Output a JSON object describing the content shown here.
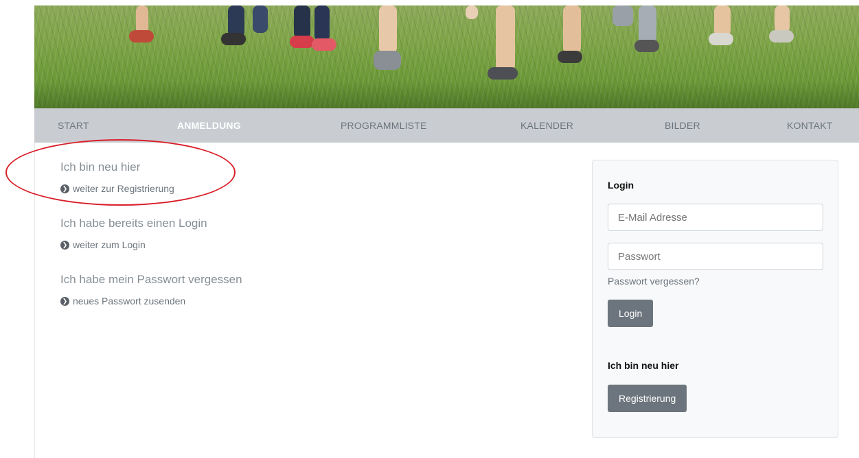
{
  "hero": {
    "alt": "children running on grass"
  },
  "nav": {
    "items": [
      {
        "label": "START",
        "active": false
      },
      {
        "label": "ANMELDUNG",
        "active": true
      },
      {
        "label": "PROGRAMMLISTE",
        "active": false
      },
      {
        "label": "KALENDER",
        "active": false
      },
      {
        "label": "BILDER",
        "active": false
      },
      {
        "label": "KONTAKT",
        "active": false
      }
    ]
  },
  "options": [
    {
      "title": "Ich bin neu hier",
      "link": "weiter zur Registrierung"
    },
    {
      "title": "Ich habe bereits einen Login",
      "link": "weiter zum Login"
    },
    {
      "title": "Ich habe mein Passwort vergessen",
      "link": "neues Passwort zusenden"
    }
  ],
  "login": {
    "heading": "Login",
    "email_placeholder": "E-Mail Adresse",
    "password_placeholder": "Passwort",
    "forgot_label": "Passwort vergessen?",
    "login_button": "Login",
    "new_heading": "Ich bin neu hier",
    "register_button": "Registrierung"
  },
  "colors": {
    "nav_bg": "#c9cdd2",
    "button_bg": "#6c757d",
    "annotation": "#d9202a"
  }
}
